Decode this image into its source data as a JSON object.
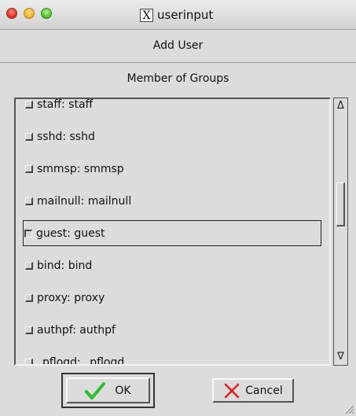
{
  "window": {
    "title": "userinput"
  },
  "dialog": {
    "heading": "Add User",
    "groups_label": "Member of Groups",
    "groups": [
      {
        "label": "staff: staff",
        "checked": false
      },
      {
        "label": "sshd: sshd",
        "checked": false
      },
      {
        "label": "smmsp: smmsp",
        "checked": false
      },
      {
        "label": "mailnull: mailnull",
        "checked": false
      },
      {
        "label": "guest: guest",
        "checked": false,
        "focused": true
      },
      {
        "label": "bind: bind",
        "checked": false
      },
      {
        "label": "proxy: proxy",
        "checked": false
      },
      {
        "label": "authpf: authpf",
        "checked": false
      },
      {
        "label": "_pflogd: _pflogd",
        "checked": false
      }
    ],
    "buttons": {
      "ok_label": "OK",
      "cancel_label": "Cancel"
    }
  },
  "icons": {
    "ok": "checkmark-icon",
    "cancel": "x-mark-icon"
  },
  "colors": {
    "ok_check": "#2bbf2b",
    "cancel_x": "#e02020"
  }
}
